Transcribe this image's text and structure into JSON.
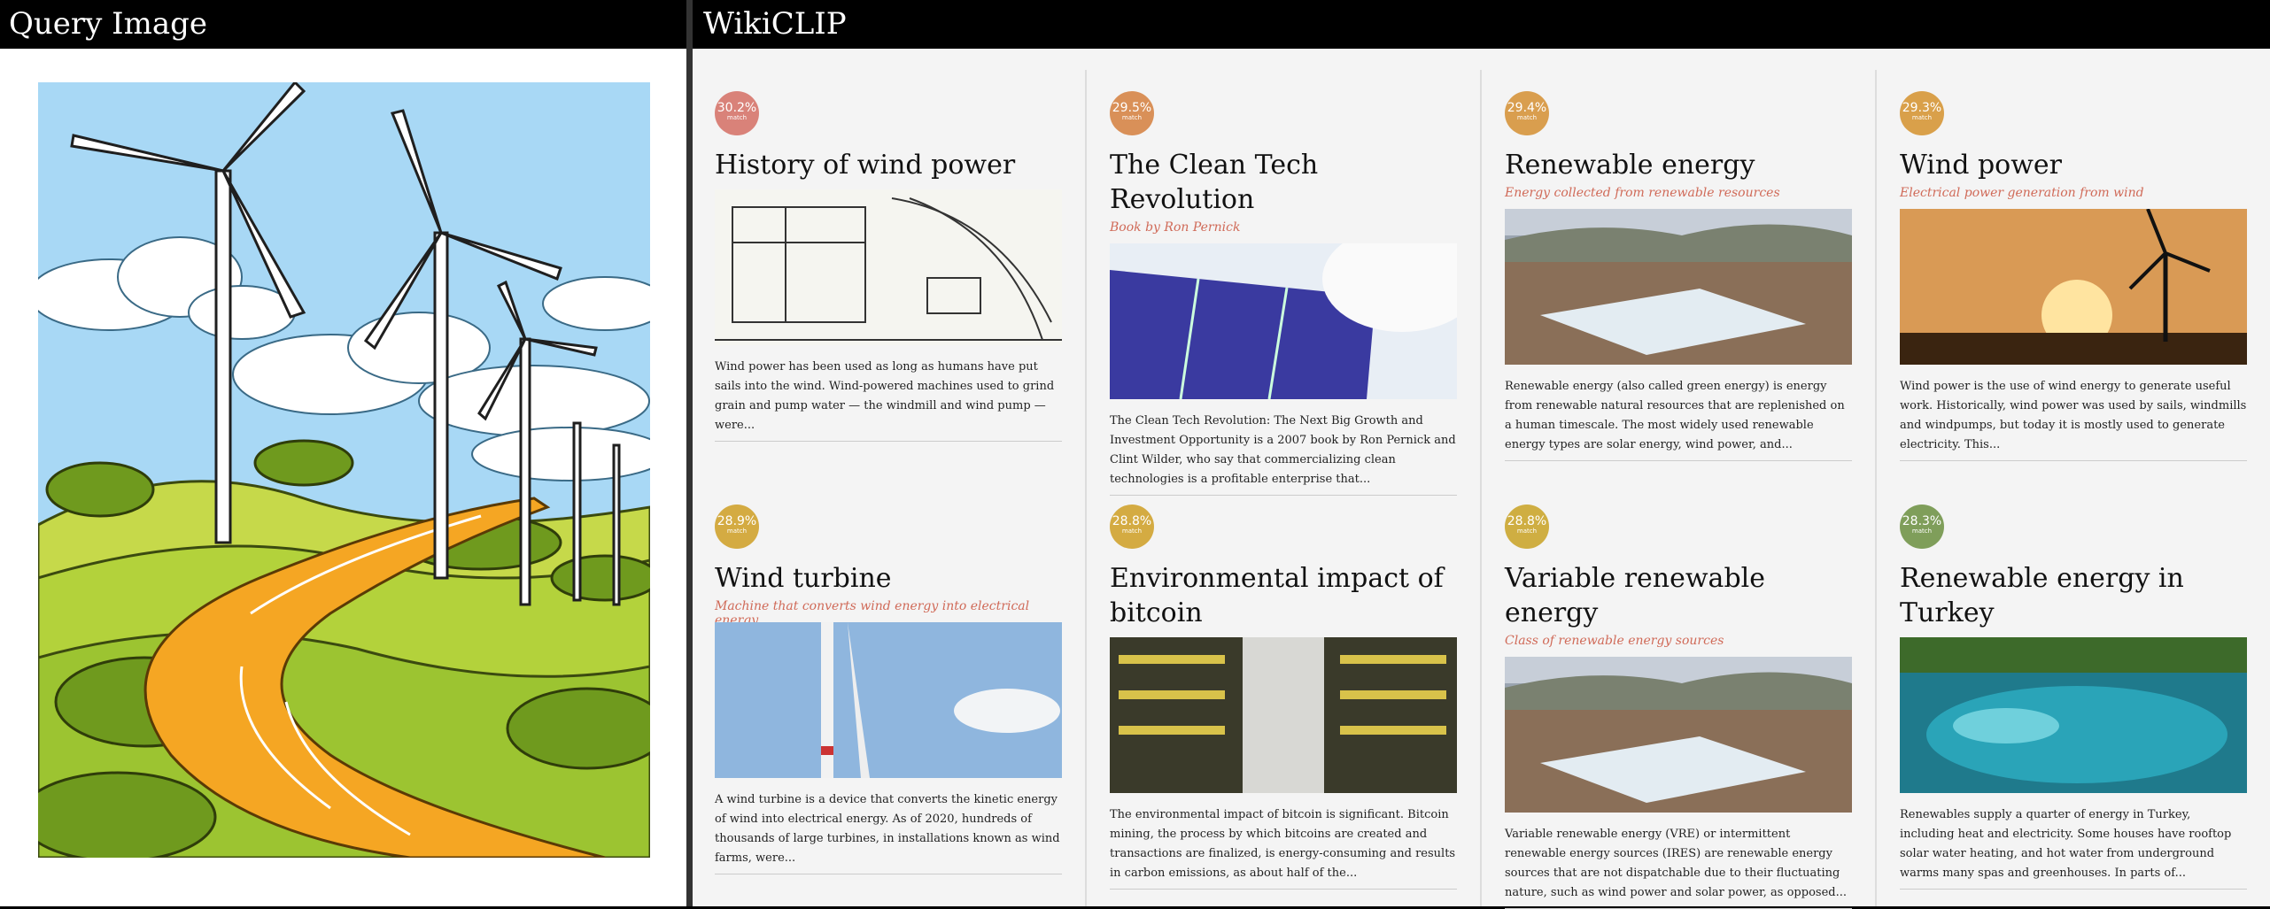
{
  "left_panel": {
    "title": "Query Image"
  },
  "right_panel": {
    "title": "WikiCLIP"
  },
  "badge_suffix": "match",
  "results": [
    {
      "score": "30.2%",
      "color": "#d98279",
      "title": "History of wind power",
      "subtitle": "",
      "image": "blueprint-drawing",
      "description": "Wind power has been used as long as humans have put sails into the wind. Wind-powered machines used to grind grain and pump water — the windmill and wind pump — were..."
    },
    {
      "score": "29.5%",
      "color": "#d99058",
      "title": "The Clean Tech Revolution",
      "subtitle": "Book by Ron Pernick",
      "image": "solar-cell",
      "description": "The Clean Tech Revolution: The Next Big Growth and Investment Opportunity is a 2007 book by Ron Pernick and Clint Wilder, who say that commercializing clean technologies is a profitable enterprise that..."
    },
    {
      "score": "29.4%",
      "color": "#d99e4e",
      "title": "Renewable energy",
      "subtitle": "Energy collected from renewable resources",
      "image": "solar-farm",
      "description": "Renewable energy (also called green energy) is energy from renewable natural resources that are replenished on a human timescale. The most widely used renewable energy types are solar energy, wind power, and..."
    },
    {
      "score": "29.3%",
      "color": "#d9a04a",
      "title": "Wind power",
      "subtitle": "Electrical power generation from wind",
      "image": "sunset-turbine",
      "description": "Wind power is the use of wind energy to generate useful work. Historically, wind power was used by sails, windmills and windpumps, but today it is mostly used to generate electricity. This..."
    },
    {
      "score": "28.9%",
      "color": "#d4ab42",
      "title": "Wind turbine",
      "subtitle": "Machine that converts wind energy into electrical energy",
      "image": "turbine-tower",
      "description": "A wind turbine is a device that converts the kinetic energy of wind into electrical energy. As of 2020, hundreds of thousands of large turbines, in installations known as wind farms, were..."
    },
    {
      "score": "28.8%",
      "color": "#d4ab42",
      "title": "Environmental impact of bitcoin",
      "subtitle": "",
      "image": "mining-rigs",
      "description": "The environmental impact of bitcoin is significant. Bitcoin mining, the process by which bitcoins are created and transactions are finalized, is energy-consuming and results in carbon emissions, as about half of the..."
    },
    {
      "score": "28.8%",
      "color": "#cfae42",
      "title": "Variable renewable energy",
      "subtitle": "Class of renewable energy sources",
      "image": "solar-farm",
      "description": "Variable renewable energy (VRE) or intermittent renewable energy sources (IRES) are renewable energy sources that are not dispatchable due to their fluctuating nature, such as wind power and solar power, as opposed..."
    },
    {
      "score": "28.3%",
      "color": "#7f9e5a",
      "title": "Renewable energy in Turkey",
      "subtitle": "",
      "image": "thermal-pool",
      "description": "Renewables supply a quarter of energy in Turkey, including heat and electricity. Some houses have rooftop solar water heating, and hot water from underground warms many spas and greenhouses. In parts of..."
    }
  ]
}
